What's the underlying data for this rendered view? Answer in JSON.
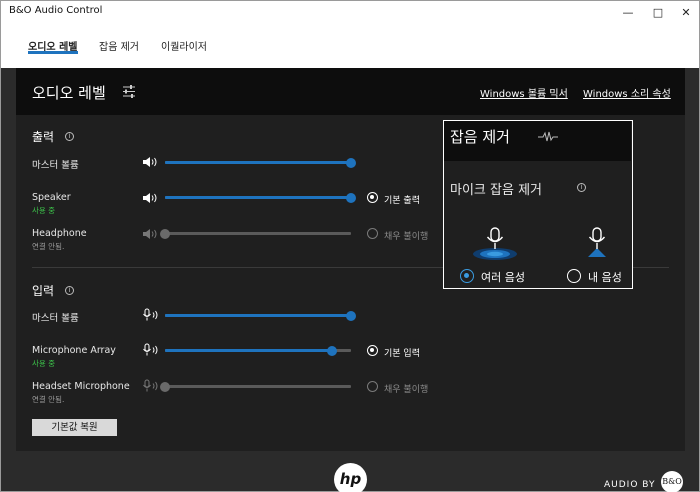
{
  "window": {
    "title": "B&O Audio Control"
  },
  "tabs": [
    {
      "label": "오디오 레벨",
      "active": true
    },
    {
      "label": "잡음 제거",
      "active": false
    },
    {
      "label": "이퀄라이저",
      "active": false
    }
  ],
  "panel": {
    "title": "오디오 레벨",
    "links": {
      "mixer": "Windows 볼륨 믹서",
      "sound_props": "Windows 소리 속성"
    }
  },
  "output": {
    "title": "출력",
    "master": {
      "label": "마스터 볼륨",
      "level": 100
    },
    "devices": [
      {
        "name": "Speaker",
        "status": "사용 중",
        "status_color": "#3cc24a",
        "level": 100,
        "enabled": true,
        "default_label": "기본 출력",
        "is_default": true
      },
      {
        "name": "Headphone",
        "status": "연결 안됨.",
        "status_color": "#9a9a9a",
        "level": 0,
        "enabled": false,
        "default_label": "채우 불이행",
        "is_default": false
      }
    ]
  },
  "input": {
    "title": "입력",
    "master": {
      "label": "마스터 볼륨",
      "level": 100
    },
    "devices": [
      {
        "name": "Microphone Array",
        "status": "사용 중",
        "status_color": "#3cc24a",
        "level": 90,
        "enabled": true,
        "default_label": "기본 입력",
        "is_default": true
      },
      {
        "name": "Headset Microphone",
        "status": "연결 안됨.",
        "status_color": "#9a9a9a",
        "level": 0,
        "enabled": false,
        "default_label": "채우 불이행",
        "is_default": false
      }
    ]
  },
  "reset_button": "기본값 복원",
  "noise_overlay": {
    "title": "잡음 제거",
    "subtitle": "마이크 잡음 제거",
    "options": [
      {
        "label": "여러 음성",
        "selected": true
      },
      {
        "label": "내 음성",
        "selected": false
      }
    ]
  },
  "footer": {
    "brand": "hp",
    "audio_by": "AUDIO BY",
    "partner": "B&O"
  },
  "colors": {
    "accent": "#1e73be",
    "status_active": "#3cc24a",
    "status_inactive": "#9a9a9a"
  }
}
